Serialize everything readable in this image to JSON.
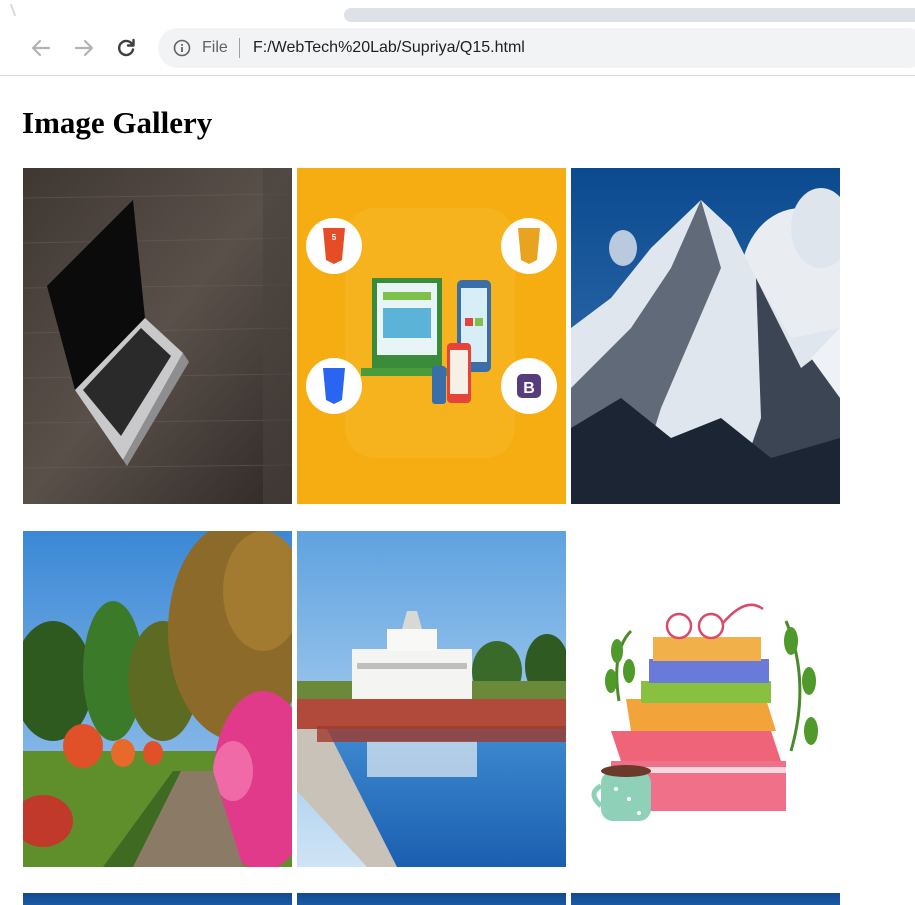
{
  "browser": {
    "back_icon": "arrow-left-icon",
    "forward_icon": "arrow-right-icon",
    "reload_icon": "reload-icon",
    "info_icon": "info-icon",
    "scheme_label": "File",
    "url": "F:/WebTech%20Lab/Supriya/Q15.html"
  },
  "page": {
    "title": "Image Gallery"
  },
  "gallery": {
    "images": [
      {
        "depicts": "laptop-on-wooden-desk"
      },
      {
        "depicts": "web-technologies-html-css-js-bootstrap"
      },
      {
        "depicts": "snowy-mountain-peak"
      },
      {
        "depicts": "garden-path-with-flowers"
      },
      {
        "depicts": "temple-with-reflecting-pool"
      },
      {
        "depicts": "stack-of-books-with-glasses-and-cup"
      },
      {
        "depicts": "partially-visible-image"
      },
      {
        "depicts": "partially-visible-image"
      },
      {
        "depicts": "partially-visible-image"
      }
    ]
  },
  "colors": {
    "toolbar_bg": "#ffffff",
    "omnibox_bg": "#f1f3f4",
    "icon_gray": "#5f6368",
    "url_text": "#202124"
  }
}
